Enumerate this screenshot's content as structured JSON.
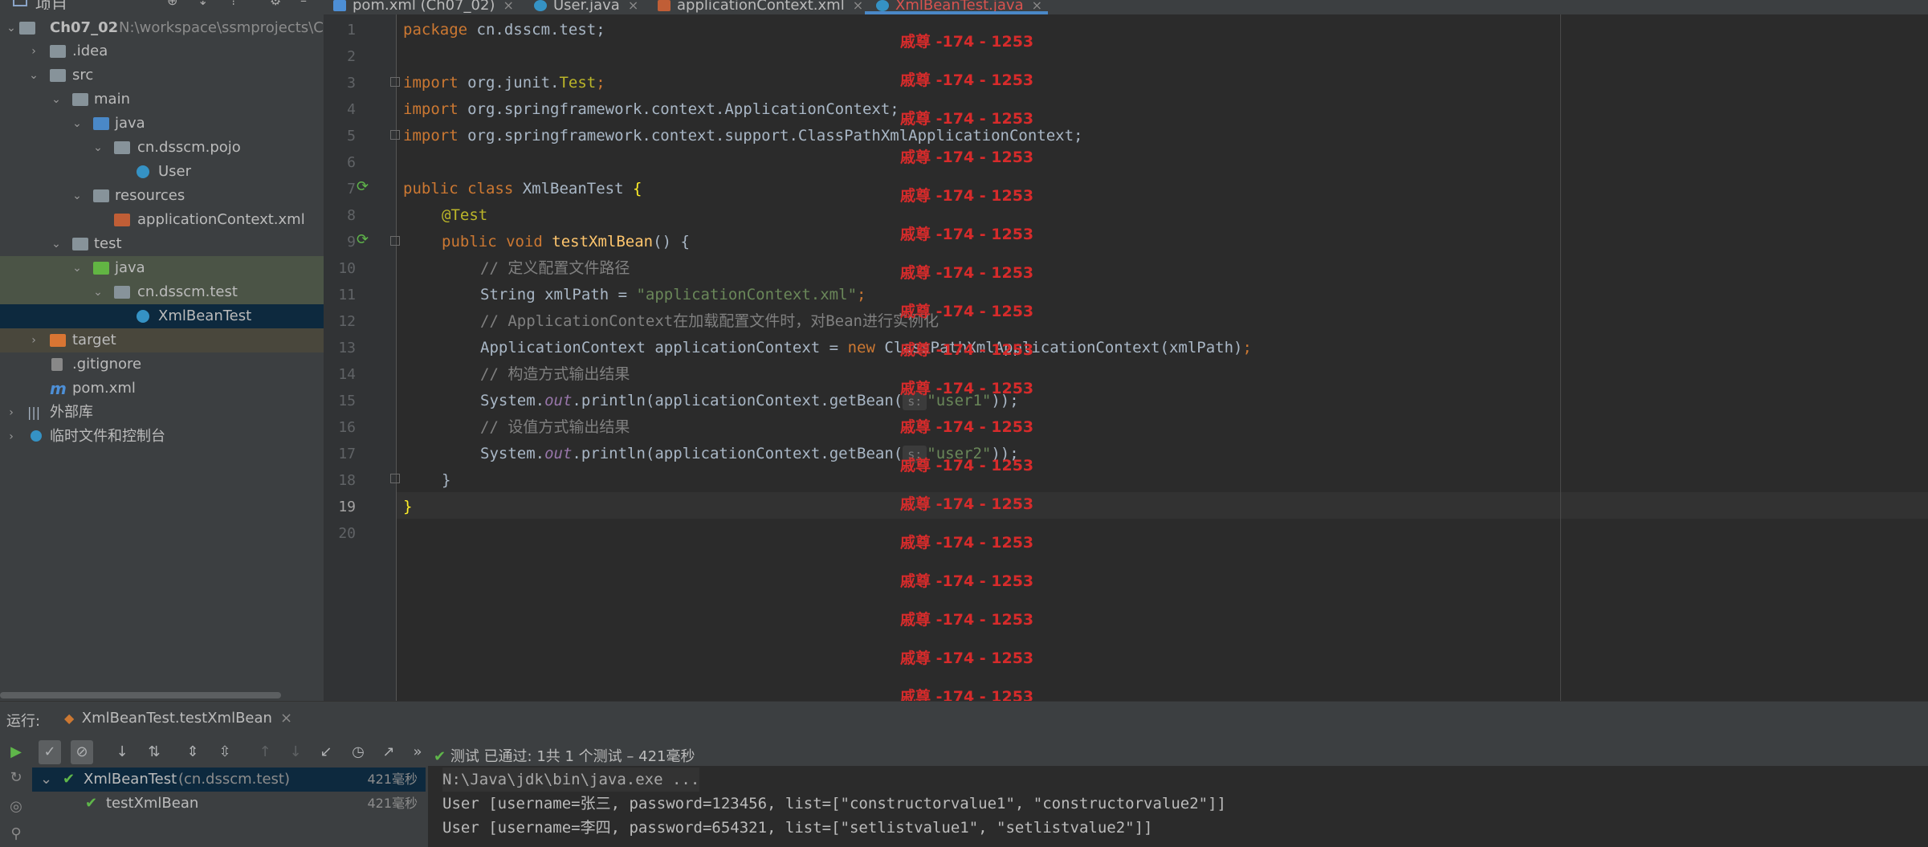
{
  "project": {
    "header_label": "项目",
    "root_name": "Ch07_02",
    "root_path": "N:\\workspace\\ssmprojects\\Ch",
    "items": [
      {
        "label": ".idea"
      },
      {
        "label": "src"
      },
      {
        "label": "main"
      },
      {
        "label": "java"
      },
      {
        "label": "cn.dsscm.pojo"
      },
      {
        "label": "User"
      },
      {
        "label": "resources"
      },
      {
        "label": "applicationContext.xml"
      },
      {
        "label": "test"
      },
      {
        "label": "java"
      },
      {
        "label": "cn.dsscm.test"
      },
      {
        "label": "XmlBeanTest"
      },
      {
        "label": "target"
      },
      {
        "label": ".gitignore"
      },
      {
        "label": "pom.xml"
      },
      {
        "label": "外部库"
      },
      {
        "label": "临时文件和控制台"
      }
    ]
  },
  "tabs": [
    {
      "label": "pom.xml (Ch07_02)",
      "icon": "maven-icon"
    },
    {
      "label": "User.java",
      "icon": "class-icon"
    },
    {
      "label": "applicationContext.xml",
      "icon": "xml-icon"
    },
    {
      "label": "XmlBeanTest.java",
      "icon": "class-icon",
      "active": true
    }
  ],
  "editor": {
    "line_numbers": [
      "1",
      "2",
      "3",
      "4",
      "5",
      "6",
      "7",
      "8",
      "9",
      "10",
      "11",
      "12",
      "13",
      "14",
      "15",
      "16",
      "17",
      "18",
      "19",
      "20"
    ],
    "code": {
      "l1_kw": "package",
      "l1_rest": " cn.dsscm.test;",
      "l3_kw": "import",
      "l3_a": " org.junit.",
      "l3_b": "Test",
      "l3_c": ";",
      "l4_kw": "import",
      "l4_rest": " org.springframework.context.ApplicationContext;",
      "l5_kw": "import",
      "l5_rest": " org.springframework.context.support.ClassPathXmlApplicationContext;",
      "l7_kw": "public class",
      "l7_name": " XmlBeanTest ",
      "l7_brace": "{",
      "l8_ann": "@Test",
      "l9_kw": "public void",
      "l9_fn": " testXmlBean",
      "l9_rest": "() {",
      "l10_cmt": "// 定义配置文件路径",
      "l11_a": "String xmlPath = ",
      "l11_str": "\"applicationContext.xml\"",
      "l11_c": ";",
      "l12_cmt": "// ApplicationContext在加载配置文件时，对Bean进行实例化",
      "l13_a": "ApplicationContext applicationContext = ",
      "l13_kw": "new",
      "l13_b": " ClassPathXmlApplicationContext(xmlPath)",
      "l13_c": ";",
      "l14_cmt": "// 构造方式输出结果",
      "l15_a": "System.",
      "l15_fld": "out",
      "l15_b": ".println(applicationContext.getBean(",
      "l15_hint": "s:",
      "l15_str": "\"user1\"",
      "l15_c": "));",
      "l16_cmt": "// 设值方式输出结果",
      "l17_a": "System.",
      "l17_fld": "out",
      "l17_b": ".println(applicationContext.getBean(",
      "l17_hint": "s:",
      "l17_str": "\"user2\"",
      "l17_c": "));",
      "l18": "}",
      "l19": "}"
    },
    "watermark": "戚尊 -174 - 1253"
  },
  "run_panel": {
    "label": "运行:",
    "tab_label": "XmlBeanTest.testXmlBean",
    "status_check": "✔",
    "status_text": "测试 已通过: 1共 1 个测试 – 421毫秒",
    "tree": [
      {
        "name": "XmlBeanTest",
        "pkg": "(cn.dsscm.test)",
        "duration": "421毫秒"
      },
      {
        "name": "testXmlBean",
        "pkg": "",
        "duration": "421毫秒"
      }
    ],
    "console": [
      "N:\\Java\\jdk\\bin\\java.exe ...",
      "User [username=张三, password=123456, list=[\"constructorvalue1\", \"constructorvalue2\"]]",
      "User [username=李四, password=654321, list=[\"setlistvalue1\", \"setlistvalue2\"]]"
    ]
  },
  "colors": {
    "editor_bg": "#2b2b2b",
    "panel_bg": "#3c3f41",
    "keyword": "#cc7832",
    "string": "#6a8759",
    "annotation": "#bbb529",
    "function": "#ffc66d",
    "watermark": "#d72b2b",
    "pass": "#5fb64a"
  }
}
